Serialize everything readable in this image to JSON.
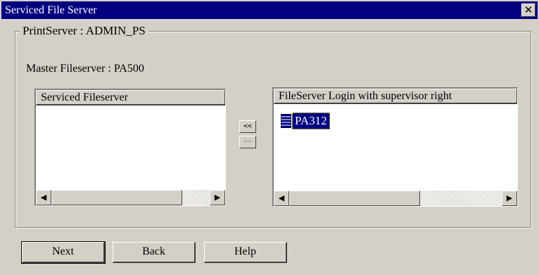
{
  "window": {
    "title": "Serviced File Server",
    "close_symbol": "✕"
  },
  "group": {
    "legend": "PrintServer : ADMIN_PS",
    "master_fileserver": "Master Fileserver : PA500"
  },
  "left_list": {
    "header": "Serviced Fileserver",
    "items": []
  },
  "right_list": {
    "header": "FileServer Login with supervisor right",
    "items": [
      {
        "label": "PA312",
        "icon": "server-icon",
        "selected": true
      }
    ]
  },
  "transfer": {
    "add_label": "<<",
    "remove_label": ">>"
  },
  "scroll": {
    "left_arrow": "◀",
    "right_arrow": "▶"
  },
  "buttons": {
    "next": "Next",
    "back": "Back",
    "help": "Help"
  }
}
